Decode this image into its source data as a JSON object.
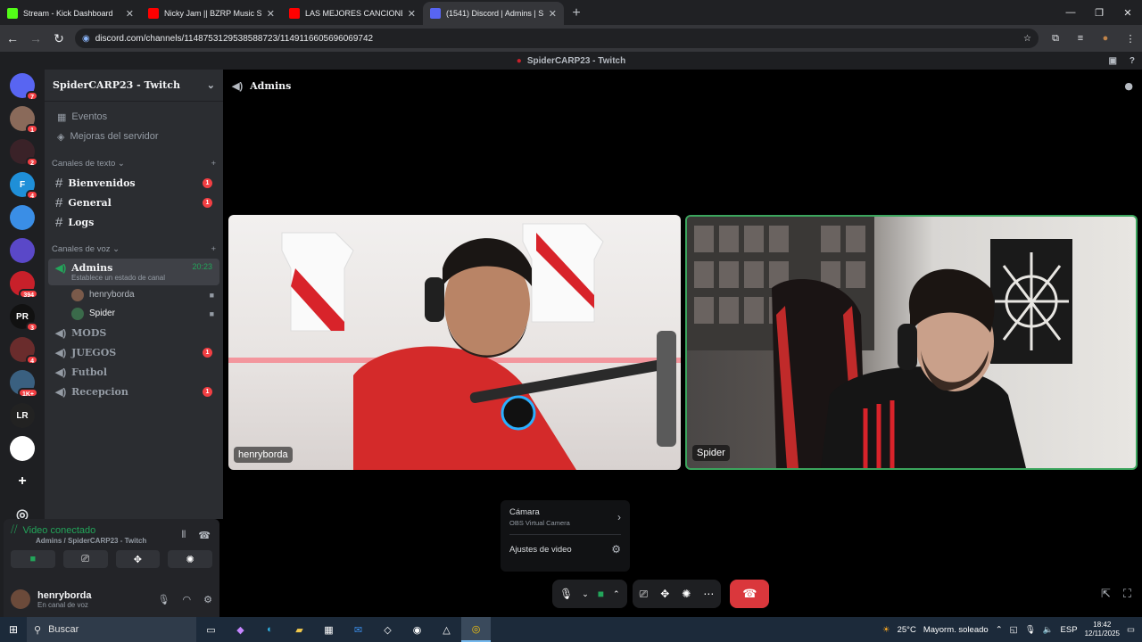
{
  "browser": {
    "tabs": [
      {
        "title": "Stream - Kick Dashboard",
        "color": "#53fc18"
      },
      {
        "title": "Nicky Jam || BZRP Music Session",
        "color": "#ff0000"
      },
      {
        "title": "LAS MEJORES CANCIONES DE",
        "color": "#ff0000"
      },
      {
        "title": "(1541) Discord | Admins | S",
        "color": "#5865f2"
      }
    ],
    "url": "discord.com/channels/1148753129538588723/1149116605696069742"
  },
  "window_title": "SpiderCARP23 - Twitch",
  "servers": [
    {
      "label": "",
      "badge": "7",
      "color": "#5865f2",
      "icon": "discord-icon"
    },
    {
      "label": "",
      "badge": "1",
      "color": "#8a6a5a"
    },
    {
      "label": "",
      "badge": "2",
      "color": "#3a2228"
    },
    {
      "label": "F",
      "badge": "4",
      "color": "#1f8fd8"
    },
    {
      "label": "",
      "badge": "",
      "color": "#3a8ee6"
    },
    {
      "label": "",
      "badge": "",
      "color": "#5a48c8"
    },
    {
      "label": "",
      "badge": "394",
      "color": "#c8202a"
    },
    {
      "label": "PR",
      "badge": "3",
      "color": "#111"
    },
    {
      "label": "",
      "badge": "4",
      "color": "#6a2c2c"
    },
    {
      "label": "",
      "badge": "1K+",
      "color": "#3a6080"
    },
    {
      "label": "LR",
      "badge": "",
      "color": "#222"
    },
    {
      "label": "",
      "badge": "",
      "color": "#ffffff"
    }
  ],
  "guild": {
    "name": "SpiderCARP23 - Twitch",
    "events": "Eventos",
    "boost": "Mejoras del servidor",
    "text_category": "Canales de texto",
    "text_channels": [
      {
        "name": "Bienvenidos",
        "badge": "1"
      },
      {
        "name": "General",
        "badge": "1"
      },
      {
        "name": "Logs",
        "badge": ""
      }
    ],
    "voice_category": "Canales de voz",
    "active_voice": {
      "name": "Admins",
      "time": "20:23",
      "status": "Establece un estado de canal"
    },
    "voice_users": [
      "henryborda",
      "Spider"
    ],
    "voice_channels": [
      {
        "name": "MODS",
        "badge": ""
      },
      {
        "name": "JUEGOS",
        "badge": "1"
      },
      {
        "name": "Futbol",
        "badge": ""
      },
      {
        "name": "Recepcion",
        "badge": "1"
      }
    ]
  },
  "voice_panel": {
    "status": "Video conectado",
    "location": "Admins / SpiderCARP23 - Twitch"
  },
  "user": {
    "name": "henryborda",
    "status": "En canal de voz"
  },
  "channel_header": "Admins",
  "tiles": [
    "henryborda",
    "Spider"
  ],
  "popup": {
    "camera_label": "Cámara",
    "camera_device": "OBS Virtual Camera",
    "video_settings": "Ajustes de video"
  },
  "taskbar": {
    "search": "Buscar",
    "weather": "25°C",
    "weather_desc": "Mayorm. soleado",
    "lang": "ESP",
    "time": "18:42",
    "date": "12/11/2025"
  }
}
